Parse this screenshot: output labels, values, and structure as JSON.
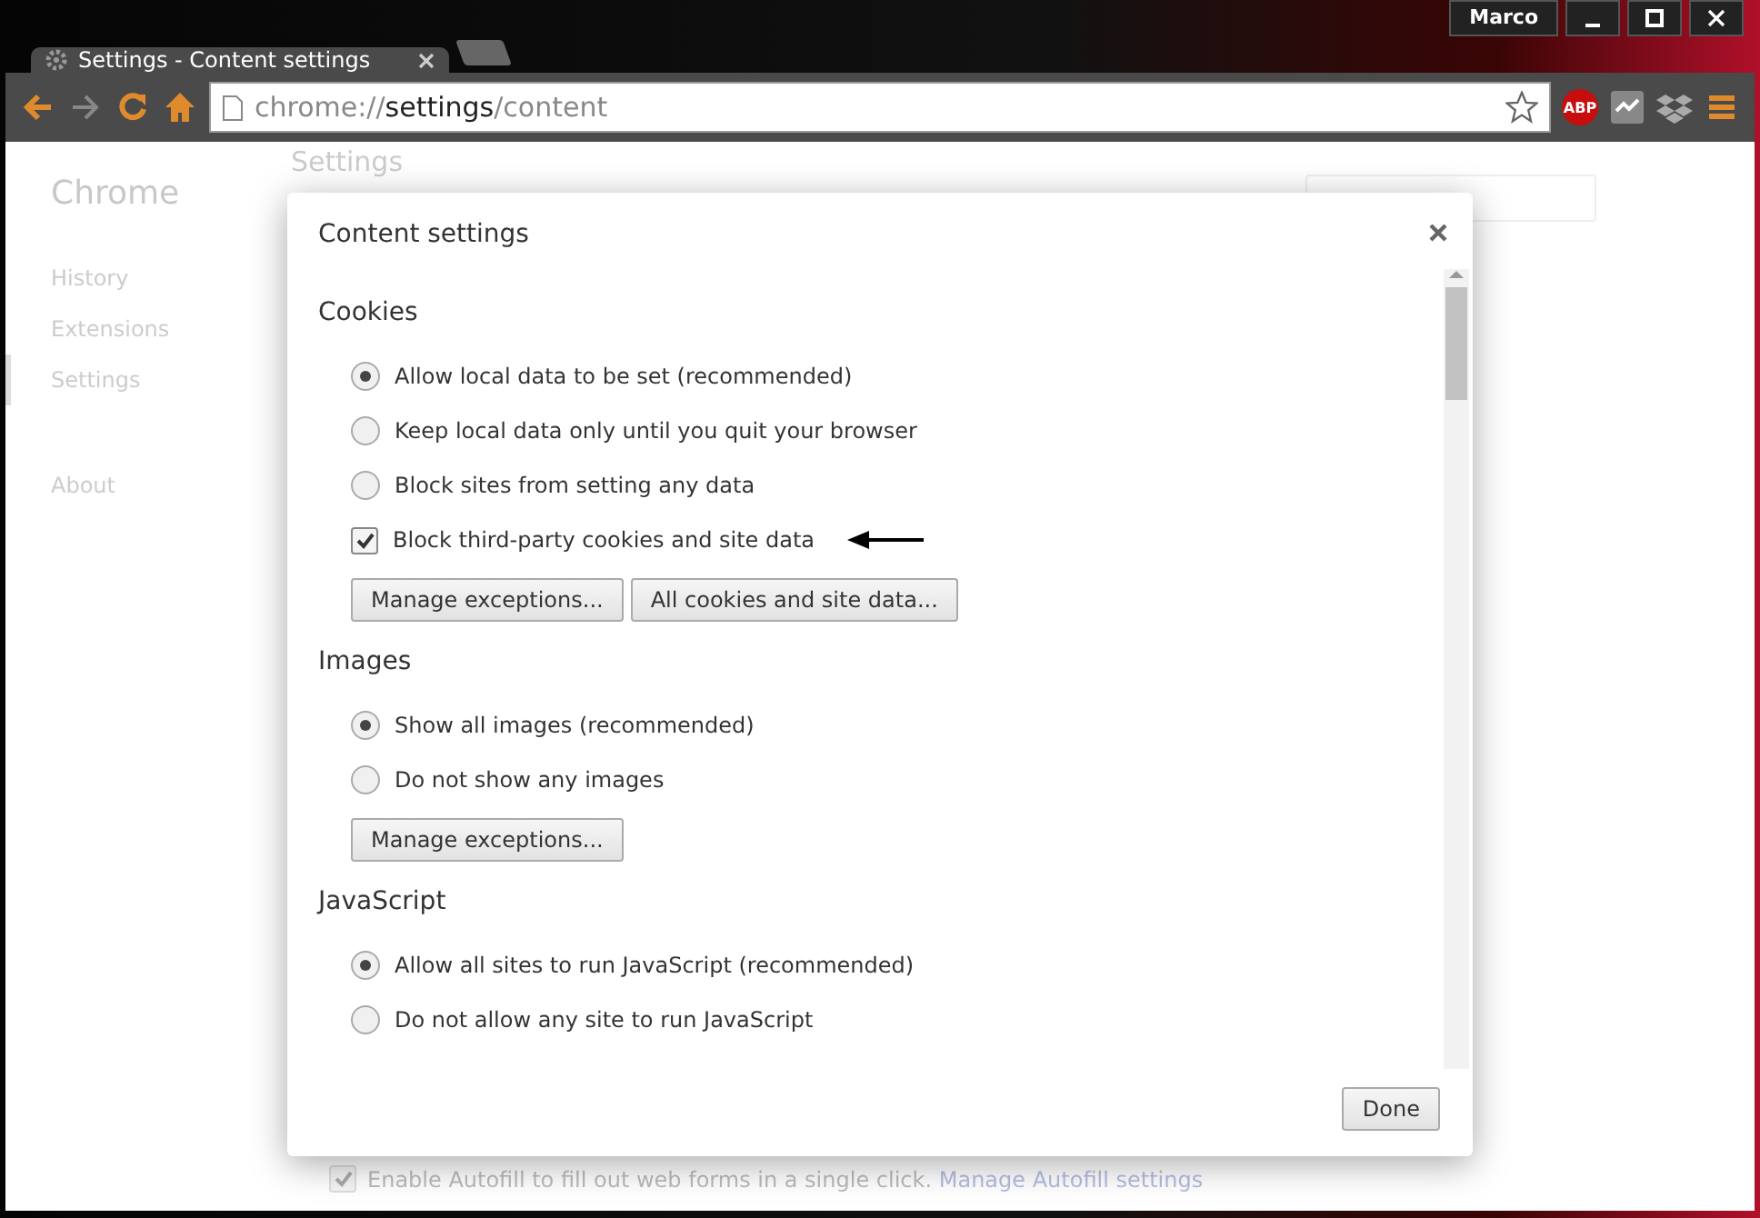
{
  "window": {
    "user": "Marco"
  },
  "tabs": [
    {
      "title": "Settings - Content settings",
      "selected": true
    }
  ],
  "address_bar": {
    "scheme": "chrome://",
    "host": "settings",
    "path": "/content"
  },
  "extensions": [
    "ABP"
  ],
  "sidebar": {
    "title": "Chrome",
    "items": [
      {
        "label": "History",
        "selected": false
      },
      {
        "label": "Extensions",
        "selected": false
      },
      {
        "label": "Settings",
        "selected": true
      },
      {
        "label": "About",
        "selected": false
      }
    ]
  },
  "page": {
    "heading": "Settings",
    "autofill": {
      "label": "Enable Autofill to fill out web forms in a single click.",
      "link": "Manage Autofill settings",
      "checked": true
    }
  },
  "dialog": {
    "title": "Content settings",
    "sections": [
      {
        "title": "Cookies",
        "options": [
          {
            "kind": "radio",
            "label": "Allow local data to be set (recommended)",
            "selected": true
          },
          {
            "kind": "radio",
            "label": "Keep local data only until you quit your browser",
            "selected": false
          },
          {
            "kind": "radio",
            "label": "Block sites from setting any data",
            "selected": false
          },
          {
            "kind": "checkbox",
            "label": "Block third-party cookies and site data",
            "checked": true,
            "arrow": true
          }
        ],
        "buttons": [
          "Manage exceptions...",
          "All cookies and site data..."
        ]
      },
      {
        "title": "Images",
        "options": [
          {
            "kind": "radio",
            "label": "Show all images (recommended)",
            "selected": true
          },
          {
            "kind": "radio",
            "label": "Do not show any images",
            "selected": false
          }
        ],
        "buttons": [
          "Manage exceptions..."
        ]
      },
      {
        "title": "JavaScript",
        "options": [
          {
            "kind": "radio",
            "label": "Allow all sites to run JavaScript (recommended)",
            "selected": true
          },
          {
            "kind": "radio",
            "label": "Do not allow any site to run JavaScript",
            "selected": false
          }
        ]
      }
    ],
    "done": "Done"
  }
}
